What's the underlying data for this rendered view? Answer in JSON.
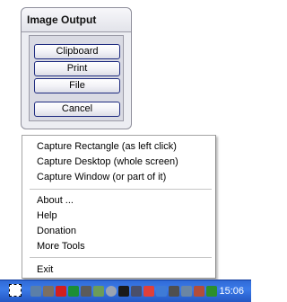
{
  "panel": {
    "title": "Image Output",
    "buttons": {
      "clipboard": "Clipboard",
      "print": "Print",
      "file": "File",
      "cancel": "Cancel"
    }
  },
  "menu": {
    "capture_rectangle": "Capture Rectangle (as left click)",
    "capture_desktop": "Capture Desktop (whole screen)",
    "capture_window": "Capture Window (or part of it)",
    "about": "About ...",
    "help": "Help",
    "donation": "Donation",
    "more_tools": "More Tools",
    "exit": "Exit"
  },
  "tray": {
    "clock": "15:06",
    "icons": [
      "capture-tray-icon",
      "network-icon",
      "tool-icon",
      "antivirus-icon",
      "shield-icon",
      "printer-icon",
      "gear-icon",
      "clock-icon",
      "cursor-icon",
      "volume-icon",
      "battery-icon",
      "security-icon"
    ]
  }
}
